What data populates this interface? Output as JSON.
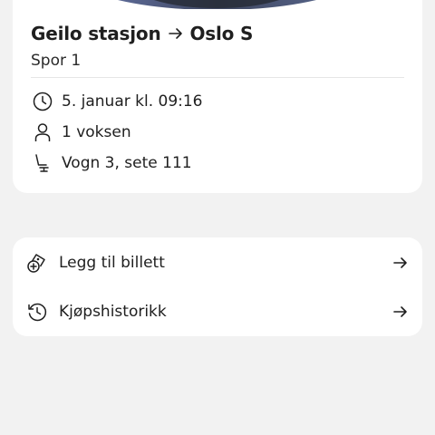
{
  "ticket": {
    "from": "Geilo stasjon",
    "to": "Oslo S",
    "platform": "Spor 1",
    "details": {
      "time": "5. januar kl. 09:16",
      "travelers": "1 voksen",
      "seat": "Vogn 3, sete 111"
    }
  },
  "actions": [
    {
      "label": "Legg til billett",
      "icon": "ticket-add-icon"
    },
    {
      "label": "Kjøpshistorikk",
      "icon": "history-icon"
    }
  ],
  "colors": {
    "background": "#f2f2f2",
    "card": "#ffffff",
    "text": "#1f1f1f",
    "hero_sky": "#5f6b9a",
    "hero_dark": "#2b2f3d"
  }
}
